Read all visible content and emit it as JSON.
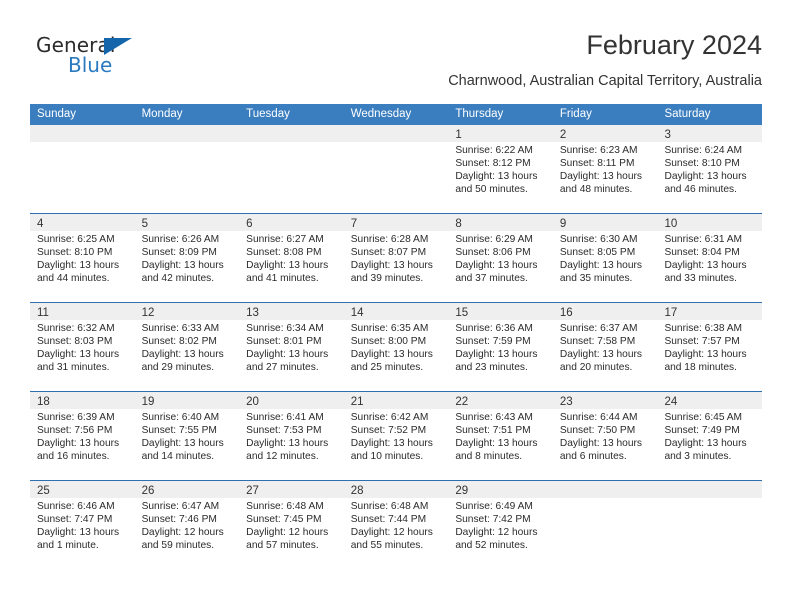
{
  "logo": {
    "word1": "General",
    "word2": "Blue",
    "triangle_color": "#1565ab",
    "blue_color": "#2a7ac0"
  },
  "header": {
    "title": "February 2024",
    "subtitle": "Charnwood, Australian Capital Territory, Australia"
  },
  "theme": {
    "header_bar": "#3b7ebf",
    "week_divider": "#2f6fb0",
    "day_band": "#efefef"
  },
  "weekdays": [
    "Sunday",
    "Monday",
    "Tuesday",
    "Wednesday",
    "Thursday",
    "Friday",
    "Saturday"
  ],
  "weeks": [
    [
      {
        "day": "",
        "sunrise": "",
        "sunset": "",
        "daylight1": "",
        "daylight2": "",
        "empty": true
      },
      {
        "day": "",
        "sunrise": "",
        "sunset": "",
        "daylight1": "",
        "daylight2": "",
        "empty": true
      },
      {
        "day": "",
        "sunrise": "",
        "sunset": "",
        "daylight1": "",
        "daylight2": "",
        "empty": true
      },
      {
        "day": "",
        "sunrise": "",
        "sunset": "",
        "daylight1": "",
        "daylight2": "",
        "empty": true
      },
      {
        "day": "1",
        "sunrise": "Sunrise: 6:22 AM",
        "sunset": "Sunset: 8:12 PM",
        "daylight1": "Daylight: 13 hours",
        "daylight2": "and 50 minutes.",
        "empty": false
      },
      {
        "day": "2",
        "sunrise": "Sunrise: 6:23 AM",
        "sunset": "Sunset: 8:11 PM",
        "daylight1": "Daylight: 13 hours",
        "daylight2": "and 48 minutes.",
        "empty": false
      },
      {
        "day": "3",
        "sunrise": "Sunrise: 6:24 AM",
        "sunset": "Sunset: 8:10 PM",
        "daylight1": "Daylight: 13 hours",
        "daylight2": "and 46 minutes.",
        "empty": false
      }
    ],
    [
      {
        "day": "4",
        "sunrise": "Sunrise: 6:25 AM",
        "sunset": "Sunset: 8:10 PM",
        "daylight1": "Daylight: 13 hours",
        "daylight2": "and 44 minutes.",
        "empty": false
      },
      {
        "day": "5",
        "sunrise": "Sunrise: 6:26 AM",
        "sunset": "Sunset: 8:09 PM",
        "daylight1": "Daylight: 13 hours",
        "daylight2": "and 42 minutes.",
        "empty": false
      },
      {
        "day": "6",
        "sunrise": "Sunrise: 6:27 AM",
        "sunset": "Sunset: 8:08 PM",
        "daylight1": "Daylight: 13 hours",
        "daylight2": "and 41 minutes.",
        "empty": false
      },
      {
        "day": "7",
        "sunrise": "Sunrise: 6:28 AM",
        "sunset": "Sunset: 8:07 PM",
        "daylight1": "Daylight: 13 hours",
        "daylight2": "and 39 minutes.",
        "empty": false
      },
      {
        "day": "8",
        "sunrise": "Sunrise: 6:29 AM",
        "sunset": "Sunset: 8:06 PM",
        "daylight1": "Daylight: 13 hours",
        "daylight2": "and 37 minutes.",
        "empty": false
      },
      {
        "day": "9",
        "sunrise": "Sunrise: 6:30 AM",
        "sunset": "Sunset: 8:05 PM",
        "daylight1": "Daylight: 13 hours",
        "daylight2": "and 35 minutes.",
        "empty": false
      },
      {
        "day": "10",
        "sunrise": "Sunrise: 6:31 AM",
        "sunset": "Sunset: 8:04 PM",
        "daylight1": "Daylight: 13 hours",
        "daylight2": "and 33 minutes.",
        "empty": false
      }
    ],
    [
      {
        "day": "11",
        "sunrise": "Sunrise: 6:32 AM",
        "sunset": "Sunset: 8:03 PM",
        "daylight1": "Daylight: 13 hours",
        "daylight2": "and 31 minutes.",
        "empty": false
      },
      {
        "day": "12",
        "sunrise": "Sunrise: 6:33 AM",
        "sunset": "Sunset: 8:02 PM",
        "daylight1": "Daylight: 13 hours",
        "daylight2": "and 29 minutes.",
        "empty": false
      },
      {
        "day": "13",
        "sunrise": "Sunrise: 6:34 AM",
        "sunset": "Sunset: 8:01 PM",
        "daylight1": "Daylight: 13 hours",
        "daylight2": "and 27 minutes.",
        "empty": false
      },
      {
        "day": "14",
        "sunrise": "Sunrise: 6:35 AM",
        "sunset": "Sunset: 8:00 PM",
        "daylight1": "Daylight: 13 hours",
        "daylight2": "and 25 minutes.",
        "empty": false
      },
      {
        "day": "15",
        "sunrise": "Sunrise: 6:36 AM",
        "sunset": "Sunset: 7:59 PM",
        "daylight1": "Daylight: 13 hours",
        "daylight2": "and 23 minutes.",
        "empty": false
      },
      {
        "day": "16",
        "sunrise": "Sunrise: 6:37 AM",
        "sunset": "Sunset: 7:58 PM",
        "daylight1": "Daylight: 13 hours",
        "daylight2": "and 20 minutes.",
        "empty": false
      },
      {
        "day": "17",
        "sunrise": "Sunrise: 6:38 AM",
        "sunset": "Sunset: 7:57 PM",
        "daylight1": "Daylight: 13 hours",
        "daylight2": "and 18 minutes.",
        "empty": false
      }
    ],
    [
      {
        "day": "18",
        "sunrise": "Sunrise: 6:39 AM",
        "sunset": "Sunset: 7:56 PM",
        "daylight1": "Daylight: 13 hours",
        "daylight2": "and 16 minutes.",
        "empty": false
      },
      {
        "day": "19",
        "sunrise": "Sunrise: 6:40 AM",
        "sunset": "Sunset: 7:55 PM",
        "daylight1": "Daylight: 13 hours",
        "daylight2": "and 14 minutes.",
        "empty": false
      },
      {
        "day": "20",
        "sunrise": "Sunrise: 6:41 AM",
        "sunset": "Sunset: 7:53 PM",
        "daylight1": "Daylight: 13 hours",
        "daylight2": "and 12 minutes.",
        "empty": false
      },
      {
        "day": "21",
        "sunrise": "Sunrise: 6:42 AM",
        "sunset": "Sunset: 7:52 PM",
        "daylight1": "Daylight: 13 hours",
        "daylight2": "and 10 minutes.",
        "empty": false
      },
      {
        "day": "22",
        "sunrise": "Sunrise: 6:43 AM",
        "sunset": "Sunset: 7:51 PM",
        "daylight1": "Daylight: 13 hours",
        "daylight2": "and 8 minutes.",
        "empty": false
      },
      {
        "day": "23",
        "sunrise": "Sunrise: 6:44 AM",
        "sunset": "Sunset: 7:50 PM",
        "daylight1": "Daylight: 13 hours",
        "daylight2": "and 6 minutes.",
        "empty": false
      },
      {
        "day": "24",
        "sunrise": "Sunrise: 6:45 AM",
        "sunset": "Sunset: 7:49 PM",
        "daylight1": "Daylight: 13 hours",
        "daylight2": "and 3 minutes.",
        "empty": false
      }
    ],
    [
      {
        "day": "25",
        "sunrise": "Sunrise: 6:46 AM",
        "sunset": "Sunset: 7:47 PM",
        "daylight1": "Daylight: 13 hours",
        "daylight2": "and 1 minute.",
        "empty": false
      },
      {
        "day": "26",
        "sunrise": "Sunrise: 6:47 AM",
        "sunset": "Sunset: 7:46 PM",
        "daylight1": "Daylight: 12 hours",
        "daylight2": "and 59 minutes.",
        "empty": false
      },
      {
        "day": "27",
        "sunrise": "Sunrise: 6:48 AM",
        "sunset": "Sunset: 7:45 PM",
        "daylight1": "Daylight: 12 hours",
        "daylight2": "and 57 minutes.",
        "empty": false
      },
      {
        "day": "28",
        "sunrise": "Sunrise: 6:48 AM",
        "sunset": "Sunset: 7:44 PM",
        "daylight1": "Daylight: 12 hours",
        "daylight2": "and 55 minutes.",
        "empty": false
      },
      {
        "day": "29",
        "sunrise": "Sunrise: 6:49 AM",
        "sunset": "Sunset: 7:42 PM",
        "daylight1": "Daylight: 12 hours",
        "daylight2": "and 52 minutes.",
        "empty": false
      },
      {
        "day": "",
        "sunrise": "",
        "sunset": "",
        "daylight1": "",
        "daylight2": "",
        "empty": true
      },
      {
        "day": "",
        "sunrise": "",
        "sunset": "",
        "daylight1": "",
        "daylight2": "",
        "empty": true
      }
    ]
  ]
}
